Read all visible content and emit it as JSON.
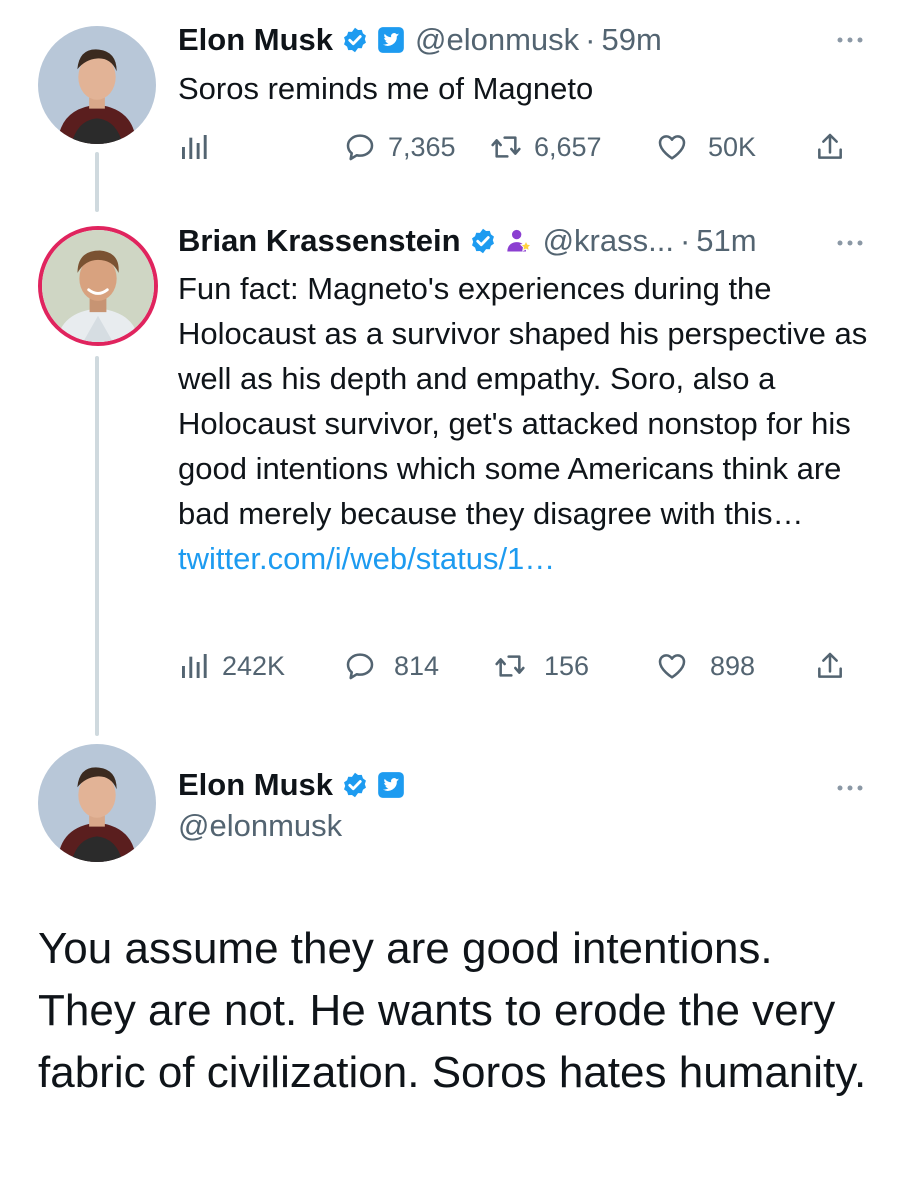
{
  "tweet1": {
    "name": "Elon Musk",
    "handle": "@elonmusk",
    "separator": "·",
    "time": "59m",
    "text": "Soros reminds me of Magneto",
    "replies": "7,365",
    "retweets": "6,657",
    "likes": "50K"
  },
  "tweet2": {
    "name": "Brian Krassenstein",
    "handle": "@krass...",
    "separator": "·",
    "time": "51m",
    "text": "Fun fact:  Magneto's experiences during the Holocaust as a survivor shaped his perspective as well as his depth and empathy.  Soro, also a Holocaust survivor, get's attacked nonstop for his good intentions which some Americans think are bad merely because they disagree with this…",
    "link": "twitter.com/i/web/status/1…",
    "views": "242K",
    "replies": "814",
    "retweets": "156",
    "likes": "898"
  },
  "tweet3": {
    "name": "Elon Musk",
    "handle": "@elonmusk",
    "text": "You assume they are good intentions. They are not. He wants to erode the very fabric of civilization. Soros hates humanity."
  },
  "icons": {
    "verified": "verified-badge-icon",
    "affiliate": "twitter-affiliate-icon",
    "gov": "government-affiliate-icon",
    "more": "more-options-icon",
    "analytics": "analytics-icon",
    "reply": "reply-icon",
    "retweet": "retweet-icon",
    "like": "like-icon",
    "share": "share-icon"
  },
  "colors": {
    "verified": "#1d9bf0",
    "link": "#1d9bf0",
    "gov_badge": "#8b3fd1",
    "muted": "#536471",
    "thread_line": "#cfd9de"
  }
}
